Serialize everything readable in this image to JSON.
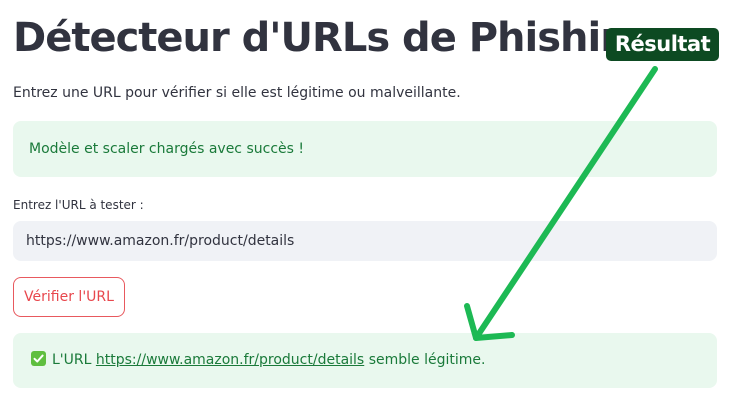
{
  "page": {
    "title": "Détecteur d'URLs de Phishing",
    "subtitle": "Entrez une URL pour vérifier si elle est légitime ou malveillante."
  },
  "annotation": {
    "badge_label": "Résultat",
    "arrow_color": "#1db954",
    "badge_color": "#0d4a22"
  },
  "status_alert": {
    "message": "Modèle et scaler chargés avec succès !"
  },
  "url_form": {
    "label": "Entrez l'URL à tester :",
    "value": "https://www.amazon.fr/product/details",
    "button_label": "Vérifier l'URL"
  },
  "result_alert": {
    "icon": "check-box-icon",
    "prefix": "L'URL",
    "url": "https://www.amazon.fr/product/details",
    "suffix": "semble légitime."
  },
  "colors": {
    "success_bg": "#e9f8ee",
    "success_text": "#1a7a3a",
    "button_accent": "#e8474d",
    "input_bg": "#f0f2f6"
  }
}
